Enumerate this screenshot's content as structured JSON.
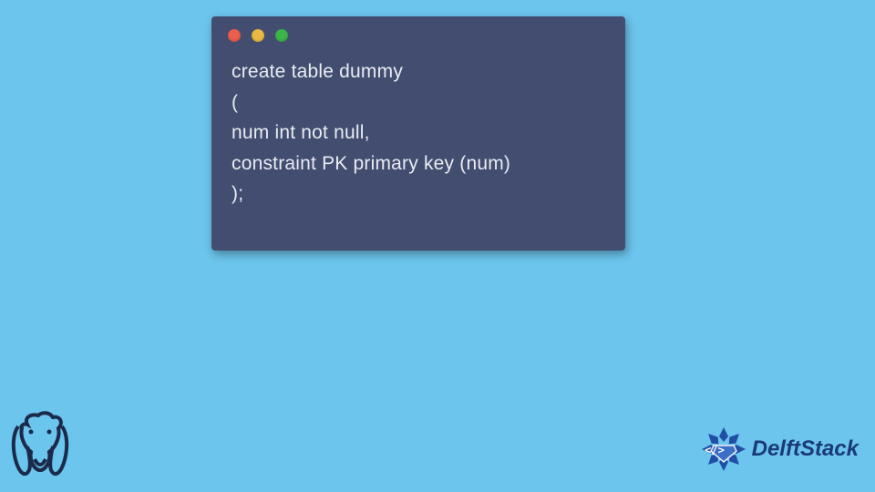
{
  "window": {
    "dots": {
      "red": "#ec5e4d",
      "yellow": "#e9b942",
      "green": "#3bb44a"
    }
  },
  "code": {
    "lines": [
      "create table dummy",
      "(",
      "num int not null,",
      "constraint PK primary key (num)",
      ");"
    ]
  },
  "brand": {
    "name": "DelftStack",
    "emblem": "code-gem-icon"
  },
  "tech_logo": "postgresql-elephant-icon"
}
